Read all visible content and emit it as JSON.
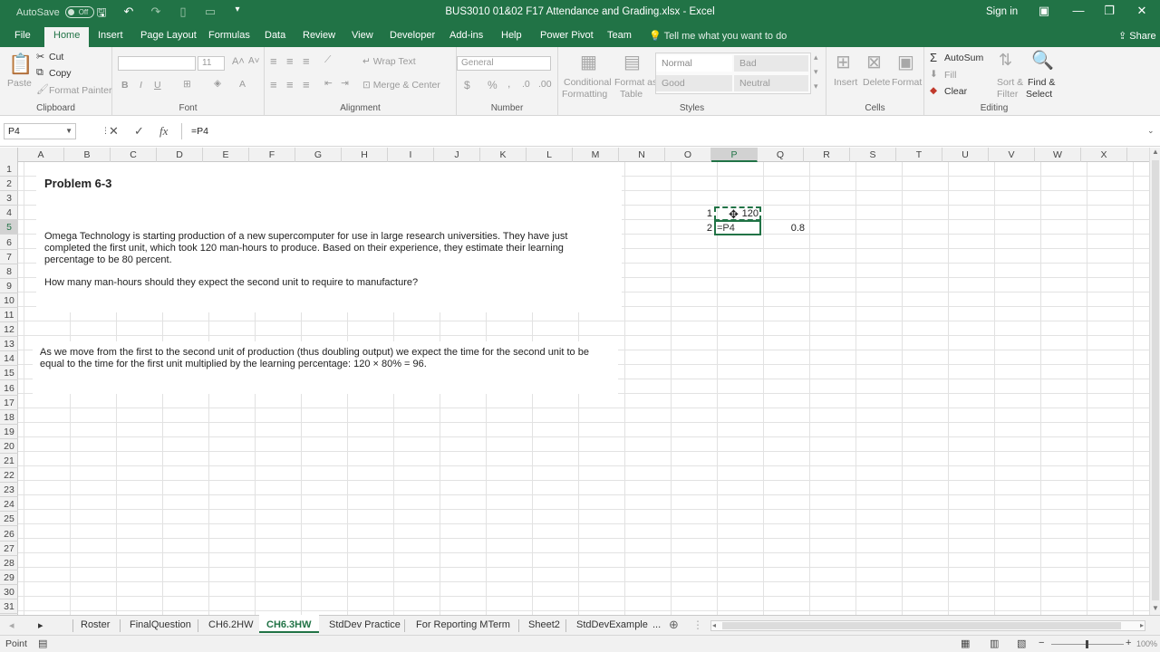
{
  "titlebar": {
    "autosave_label": "AutoSave",
    "autosave_state": "Off",
    "document_title": "BUS3010 01&02 F17 Attendance and Grading.xlsx  -  Excel",
    "signin_label": "Sign in"
  },
  "ribbon_tabs": [
    "File",
    "Home",
    "Insert",
    "Page Layout",
    "Formulas",
    "Data",
    "Review",
    "View",
    "Developer",
    "Add-ins",
    "Help",
    "Power Pivot",
    "Team"
  ],
  "tell_me": "Tell me what you want to do",
  "share_label": "Share",
  "ribbon": {
    "clipboard": {
      "paste": "Paste",
      "cut": "Cut",
      "copy": "Copy",
      "format_painter": "Format Painter",
      "label": "Clipboard"
    },
    "font": {
      "size": "11",
      "bold": "B",
      "italic": "I",
      "underline": "U",
      "label": "Font"
    },
    "alignment": {
      "wrap_text": "Wrap Text",
      "merge_center": "Merge & Center",
      "label": "Alignment"
    },
    "number": {
      "format": "General",
      "currency": "$",
      "percent": "%",
      "comma": ",",
      "label": "Number"
    },
    "styles": {
      "conditional": "Conditional",
      "formatting": "Formatting",
      "format_as": "Format as",
      "table": "Table",
      "normal": "Normal",
      "bad": "Bad",
      "good": "Good",
      "neutral": "Neutral",
      "label": "Styles"
    },
    "cells": {
      "insert": "Insert",
      "delete": "Delete",
      "format": "Format",
      "label": "Cells"
    },
    "editing": {
      "autosum": "AutoSum",
      "fill": "Fill",
      "clear": "Clear",
      "sort": "Sort &",
      "filter": "Filter",
      "find": "Find &",
      "select": "Select",
      "label": "Editing"
    }
  },
  "formula_bar": {
    "name_box": "P4",
    "cancel": "✕",
    "enter": "✓",
    "fx": "fx",
    "formula": "=P4"
  },
  "columns": [
    "A",
    "B",
    "C",
    "D",
    "E",
    "F",
    "G",
    "H",
    "I",
    "J",
    "K",
    "L",
    "M",
    "N",
    "O",
    "P",
    "Q",
    "R",
    "S",
    "T",
    "U",
    "V",
    "W",
    "X"
  ],
  "rows": [
    "1",
    "2",
    "3",
    "4",
    "5",
    "6",
    "7",
    "8",
    "9",
    "10",
    "11",
    "12",
    "13",
    "14",
    "15",
    "16",
    "17",
    "18",
    "19",
    "20",
    "21",
    "22",
    "23",
    "24",
    "25",
    "26",
    "27",
    "28",
    "29",
    "30",
    "31"
  ],
  "content": {
    "problem_title": "Problem 6-3",
    "problem_para": "Omega Technology is starting production of a new supercomputer for use in large research universities. They have just completed the first unit, which took 120 man-hours to produce. Based on their experience, they estimate their learning percentage to be 80 percent.",
    "question": "How many man-hours should they expect the second unit to require to manufacture?",
    "answer_para": "As we move from the first to the second unit of production (thus doubling output) we expect the time for the second unit to be equal to the time for the first unit multiplied by the learning percentage: 120 × 80% = 96.",
    "o4": "1",
    "p4": "120",
    "o5": "2",
    "p5_editing": "=P4",
    "q5": "0.8"
  },
  "sheet_tabs": [
    "Roster",
    "FinalQuestion",
    "CH6.2HW",
    "CH6.3HW",
    "StdDev Practice",
    "For Reporting MTerm",
    "Sheet2",
    "StdDevExample"
  ],
  "active_sheet": "CH6.3HW",
  "more_tabs": "...",
  "status": {
    "mode": "Point",
    "zoom": "100%"
  }
}
